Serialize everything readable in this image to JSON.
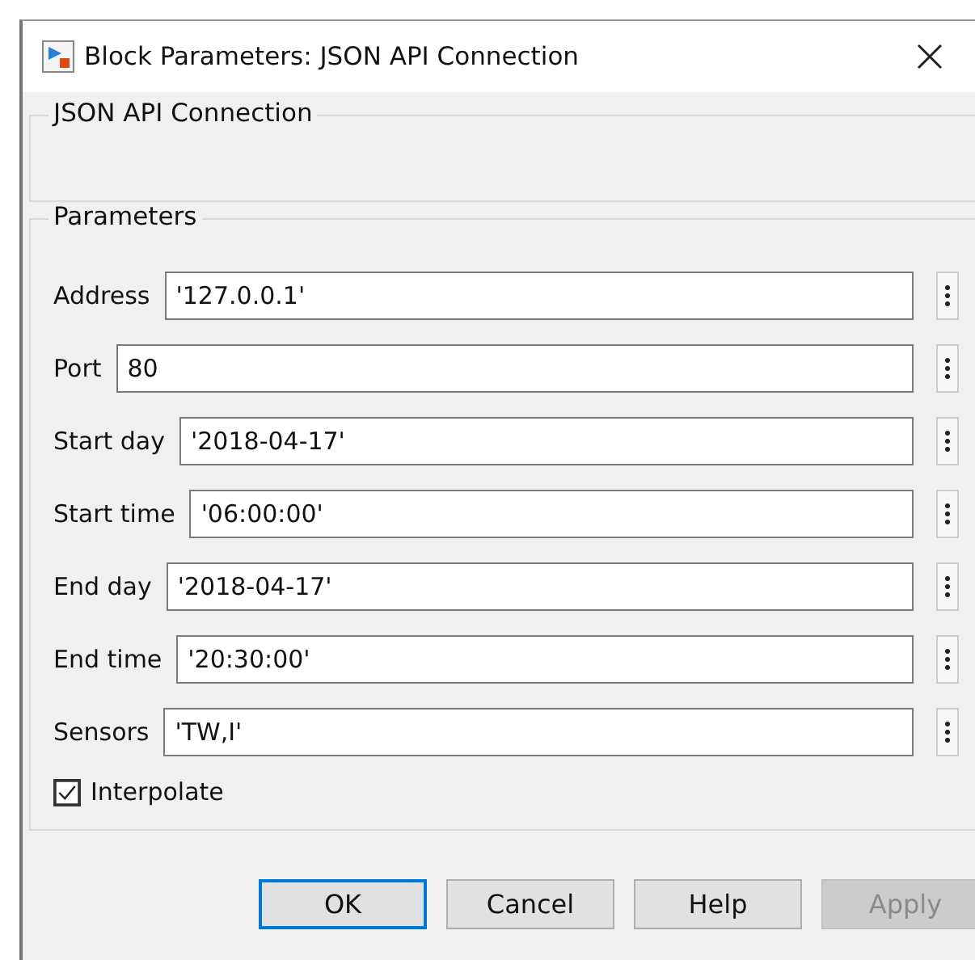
{
  "window": {
    "title": "Block Parameters: JSON API Connection"
  },
  "description_group": {
    "title": "JSON API Connection"
  },
  "parameters_group": {
    "title": "Parameters",
    "fields": [
      {
        "label": "Address",
        "value": "'127.0.0.1'"
      },
      {
        "label": "Port",
        "value": "80"
      },
      {
        "label": "Start day",
        "value": "'2018-04-17'"
      },
      {
        "label": "Start time",
        "value": "'06:00:00'"
      },
      {
        "label": "End day",
        "value": "'2018-04-17'"
      },
      {
        "label": "End time",
        "value": "'20:30:00'"
      },
      {
        "label": "Sensors",
        "value": "'TW,I'"
      }
    ],
    "checkbox": {
      "label": "Interpolate",
      "checked": true
    }
  },
  "buttons": [
    {
      "label": "OK",
      "default": true,
      "disabled": false
    },
    {
      "label": "Cancel",
      "default": false,
      "disabled": false
    },
    {
      "label": "Help",
      "default": false,
      "disabled": false
    },
    {
      "label": "Apply",
      "default": false,
      "disabled": true
    }
  ]
}
